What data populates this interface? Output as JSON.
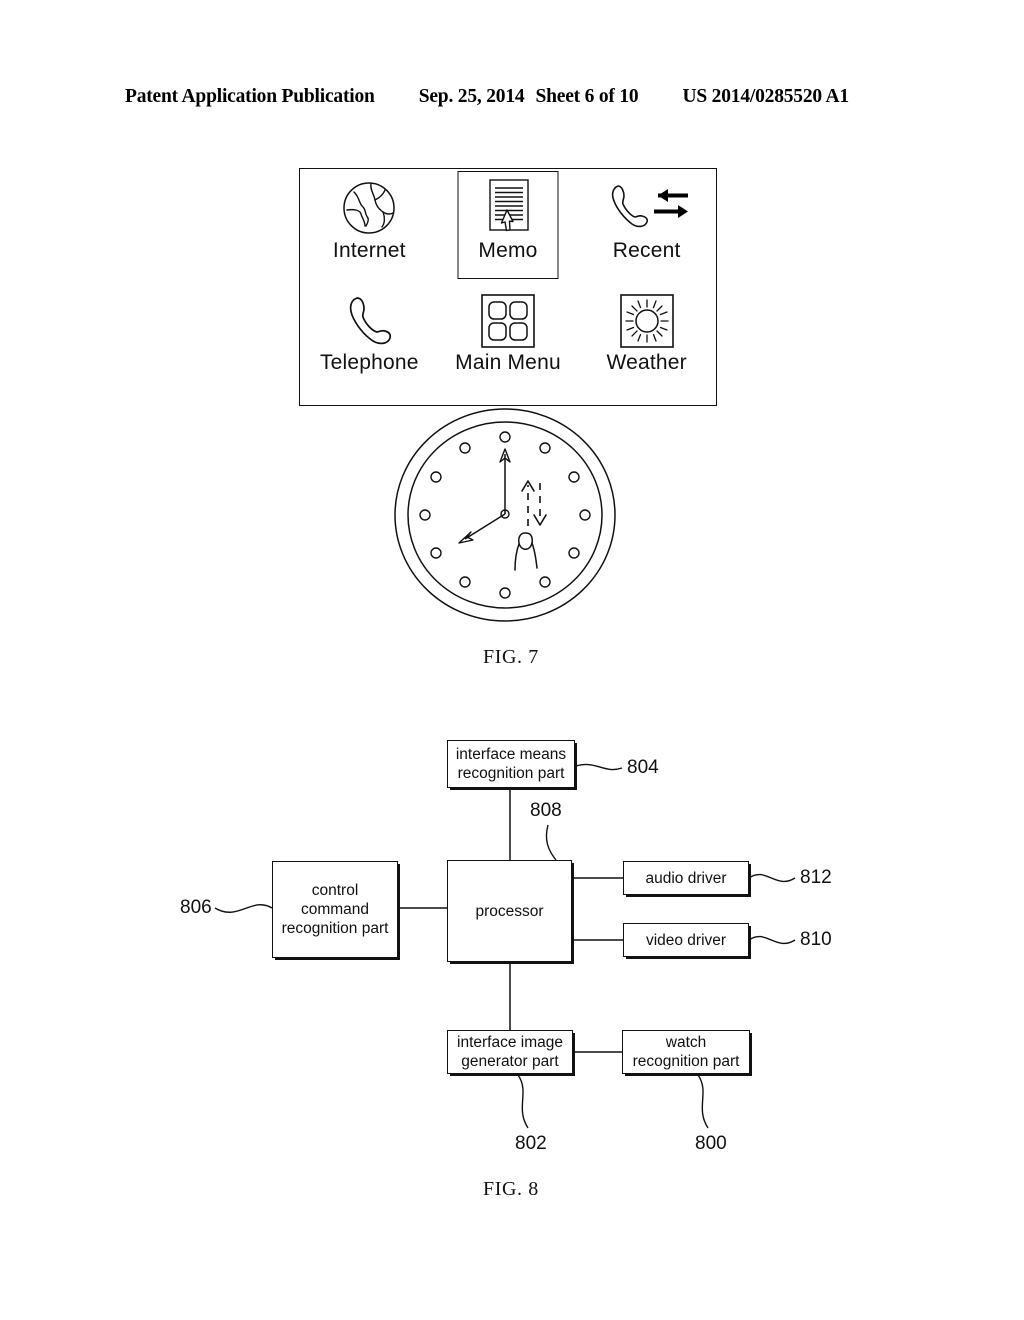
{
  "header": {
    "publication": "Patent Application Publication",
    "date": "Sep. 25, 2014",
    "sheet": "Sheet 6 of 10",
    "patent_number": "US 2014/0285520 A1"
  },
  "fig7": {
    "caption": "FIG. 7",
    "menu_items": [
      {
        "label": "Internet",
        "icon": "globe-icon",
        "selected": false
      },
      {
        "label": "Memo",
        "icon": "document-icon",
        "selected": true
      },
      {
        "label": "Recent",
        "icon": "call-log-icon",
        "selected": false
      },
      {
        "label": "Telephone",
        "icon": "handset-icon",
        "selected": false
      },
      {
        "label": "Main Menu",
        "icon": "grid-icon",
        "selected": false
      },
      {
        "label": "Weather",
        "icon": "sun-icon",
        "selected": false
      }
    ],
    "watch": {
      "icon": "analog-watch-face",
      "hour_markers": 12,
      "minute_hand_direction": "up",
      "hour_hand_direction": "lower-left",
      "gesture": "finger-swipe-up-down",
      "gesture_arrows": [
        "up",
        "down"
      ]
    }
  },
  "fig8": {
    "caption": "FIG. 8",
    "blocks": [
      {
        "id": "804",
        "label": "interface means\nrecognition part",
        "line1": "interface means",
        "line2": "recognition part"
      },
      {
        "id": "806",
        "label": "control command recognition part",
        "line1": "control",
        "line2": "command",
        "line3": "recognition part"
      },
      {
        "id": "808",
        "label": "processor",
        "line1": "processor"
      },
      {
        "id": "812",
        "label": "audio driver",
        "line1": "audio driver"
      },
      {
        "id": "810",
        "label": "video driver",
        "line1": "video driver"
      },
      {
        "id": "802",
        "label": "interface image generator part",
        "line1": "interface image",
        "line2": "generator part"
      },
      {
        "id": "800",
        "label": "watch recognition part",
        "line1": "watch",
        "line2": "recognition part"
      }
    ],
    "reference_numerals": {
      "r800": "800",
      "r802": "802",
      "r804": "804",
      "r806": "806",
      "r808": "808",
      "r810": "810",
      "r812": "812"
    }
  },
  "colors": {
    "ink": "#111111",
    "paper": "#ffffff"
  }
}
